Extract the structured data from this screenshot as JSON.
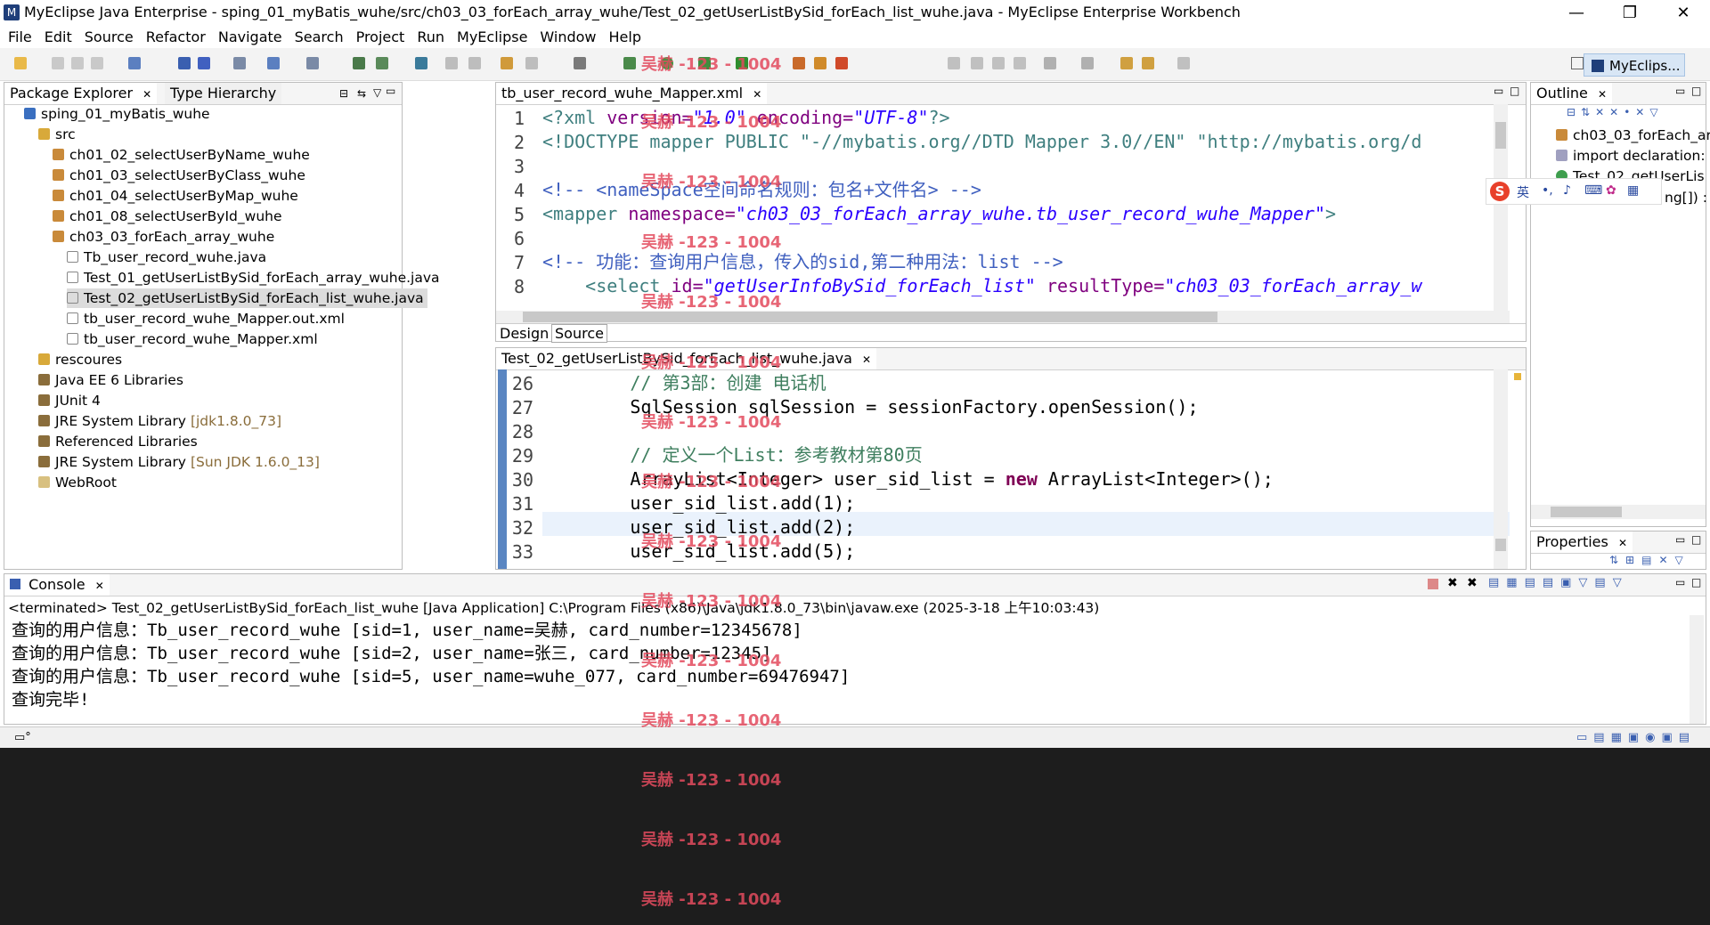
{
  "window": {
    "title": "MyEclipse Java Enterprise - sping_01_myBatis_wuhe/src/ch03_03_forEach_array_wuhe/Test_02_getUserListBySid_forEach_list_wuhe.java - MyEclipse Enterprise Workbench",
    "minimize": "—",
    "restore": "❐",
    "close": "✕"
  },
  "menu": [
    "File",
    "Edit",
    "Source",
    "Refactor",
    "Navigate",
    "Search",
    "Project",
    "Run",
    "MyEclipse",
    "Window",
    "Help"
  ],
  "perspective_label": "MyEclips...",
  "package_explorer": {
    "tab_label": "Package Explorer",
    "hierarchy_tab_label": "Type Hierarchy",
    "items": [
      {
        "label": "sping_01_myBatis_wuhe",
        "suffix": ""
      },
      {
        "label": "src",
        "suffix": ""
      },
      {
        "label": "ch01_02_selectUserByName_wuhe",
        "suffix": ""
      },
      {
        "label": "ch01_03_selectUserByClass_wuhe",
        "suffix": ""
      },
      {
        "label": "ch01_04_selectUserByMap_wuhe",
        "suffix": ""
      },
      {
        "label": "ch01_08_selectUserById_wuhe",
        "suffix": ""
      },
      {
        "label": "ch03_03_forEach_array_wuhe",
        "suffix": ""
      },
      {
        "label": "Tb_user_record_wuhe.java",
        "suffix": ""
      },
      {
        "label": "Test_01_getUserListBySid_forEach_array_wuhe.java",
        "suffix": ""
      },
      {
        "label": "Test_02_getUserListBySid_forEach_list_wuhe.java",
        "suffix": ""
      },
      {
        "label": "tb_user_record_wuhe_Mapper.out.xml",
        "suffix": ""
      },
      {
        "label": "tb_user_record_wuhe_Mapper.xml",
        "suffix": ""
      },
      {
        "label": "rescoures",
        "suffix": ""
      },
      {
        "label": "Java EE 6 Libraries",
        "suffix": ""
      },
      {
        "label": "JUnit 4",
        "suffix": ""
      },
      {
        "label": "JRE System Library",
        "suffix": "[jdk1.8.0_73]"
      },
      {
        "label": "Referenced Libraries",
        "suffix": ""
      },
      {
        "label": "JRE System Library",
        "suffix": "[Sun JDK 1.6.0_13]"
      },
      {
        "label": "WebRoot",
        "suffix": ""
      }
    ]
  },
  "xml_editor": {
    "tab_label": "tb_user_record_wuhe_Mapper.xml",
    "line_numbers": [
      "1",
      "2",
      "3",
      "4",
      "5",
      "6",
      "7",
      "8"
    ],
    "l1_a": "<?xml ",
    "l1_b": "version=",
    "l1_c": "\"1.0\"",
    "l1_d": " encoding=",
    "l1_e": "\"UTF-8\"",
    "l1_f": "?>",
    "l2": "<!DOCTYPE mapper PUBLIC \"-//mybatis.org//DTD Mapper 3.0//EN\" \"http://mybatis.org/d",
    "l4": "<!-- <nameSpace空间命名规则：包名+文件名> -->",
    "l5_a": "<mapper ",
    "l5_b": "namespace=",
    "l5_c": "\"ch03_03_forEach_array_wuhe.tb_user_record_wuhe_Mapper\"",
    "l5_d": ">",
    "l7": "<!-- 功能：查询用户信息，传入的sid,第二种用法：list -->",
    "l8_a": "    <select ",
    "l8_b": "id=",
    "l8_c": "\"getUserInfoBySid_forEach_list\"",
    "l8_d": " resultType=",
    "l8_e": "\"ch03_03_forEach_array_w",
    "design_tab": "Design",
    "source_tab": "Source"
  },
  "java_editor": {
    "tab_label": "Test_02_getUserListBySid_forEach_list_wuhe.java",
    "line_numbers": [
      "26",
      "27",
      "28",
      "29",
      "30",
      "31",
      "32",
      "33"
    ],
    "l26": "        // 第3部：创建 电话机",
    "l27": "        SqlSession sqlSession = sessionFactory.openSession();",
    "l29": "        // 定义一个List：参考教材第80页",
    "l30_a": "        ArrayList<Integer> user_sid_list = ",
    "l30_kw": "new",
    "l30_b": " ArrayList<Integer>();",
    "l31": "        user_sid_list.add(1);",
    "l32": "        user_sid_list.add(2);",
    "l33": "        user_sid_list.add(5);"
  },
  "outline": {
    "tab_label": "Outline",
    "items": [
      "ch03_03_forEach_ar",
      "import declaration:",
      "Test_02_getUserLis",
      "ng[]) :"
    ]
  },
  "properties": {
    "tab_label": "Properties"
  },
  "ime_toolbar": {
    "label": "英"
  },
  "console": {
    "tab_label": "Console",
    "header": "<terminated> Test_02_getUserListBySid_forEach_list_wuhe [Java Application] C:\\Program Files (x86)\\Java\\jdk1.8.0_73\\bin\\javaw.exe (2025-3-18 上午10:03:43)",
    "lines": [
      "查询的用户信息：Tb_user_record_wuhe [sid=1, user_name=吴赫, card_number=12345678]",
      "查询的用户信息：Tb_user_record_wuhe [sid=2, user_name=张三, card_number=12345]",
      "查询的用户信息：Tb_user_record_wuhe [sid=5, user_name=wuhe_077, card_number=69476947]",
      "查询完毕!"
    ]
  },
  "watermark": "吴赫 -123 - 1004",
  "colors": {
    "accent": "#1f3f7a",
    "watermark": "#e34b5e"
  }
}
